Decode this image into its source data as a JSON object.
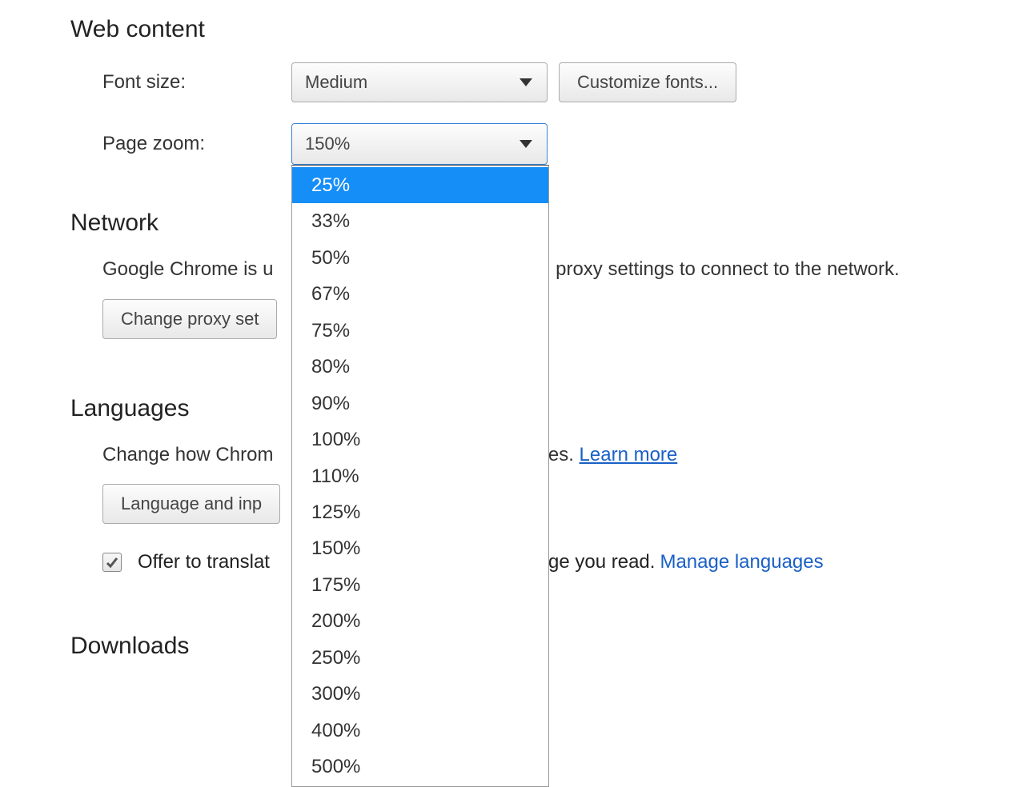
{
  "web_content": {
    "heading": "Web content",
    "font_size_label": "Font size:",
    "font_size_value": "Medium",
    "customize_fonts_btn": "Customize fonts...",
    "page_zoom_label": "Page zoom:",
    "page_zoom_value": "150%",
    "zoom_options": [
      "25%",
      "33%",
      "50%",
      "67%",
      "75%",
      "80%",
      "90%",
      "100%",
      "110%",
      "125%",
      "150%",
      "175%",
      "200%",
      "250%",
      "300%",
      "400%",
      "500%"
    ],
    "zoom_highlighted_index": 0
  },
  "network": {
    "heading": "Network",
    "desc_prefix": "Google Chrome is u",
    "desc_suffix": "m proxy settings to connect to the network.",
    "change_proxy_btn": "Change proxy set"
  },
  "languages": {
    "heading": "Languages",
    "desc_prefix": "Change how Chrom",
    "desc_suffix": "guages. ",
    "learn_more": "Learn more",
    "lang_btn": "Language and inp",
    "offer_prefix": "Offer to translat",
    "offer_suffix": "guage you read. ",
    "manage_link": "Manage languages",
    "offer_checked": true
  },
  "downloads": {
    "heading": "Downloads"
  }
}
